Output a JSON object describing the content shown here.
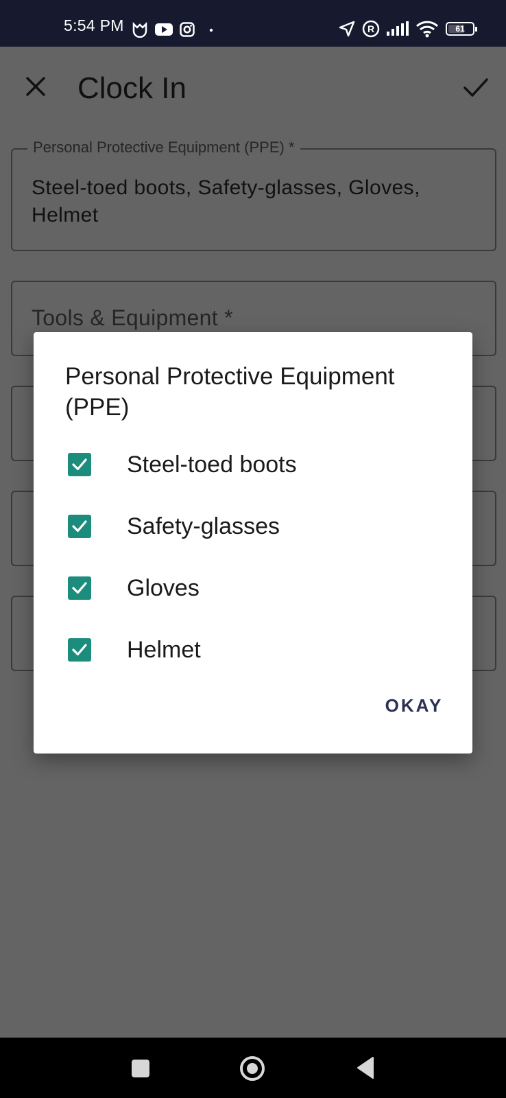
{
  "status_bar": {
    "time": "5:54 PM",
    "left_icons": [
      "mi-icon",
      "youtube-icon",
      "instagram-icon",
      "dot-icon"
    ],
    "right_icons": [
      "location-arrow-icon",
      "registered-icon",
      "signal-icon",
      "wifi-icon",
      "battery-icon"
    ],
    "battery_level": "61",
    "battery_fraction": 0.61
  },
  "app_bar": {
    "title": "Clock In",
    "close_icon": "close-icon",
    "confirm_icon": "check-icon"
  },
  "form": {
    "ppe_field": {
      "label": "Personal Protective Equipment (PPE) *",
      "value": "Steel-toed boots, Safety-glasses, Gloves, Helmet"
    },
    "tools_field": {
      "placeholder": "Tools & Equipment *"
    }
  },
  "dialog": {
    "title": "Personal Protective Equipment (PPE)",
    "options": [
      {
        "label": "Steel-toed boots",
        "checked": true
      },
      {
        "label": "Safety-glasses",
        "checked": true
      },
      {
        "label": "Gloves",
        "checked": true
      },
      {
        "label": "Helmet",
        "checked": true
      }
    ],
    "okay_label": "OKAY"
  },
  "colors": {
    "scrim": "#646464",
    "status_bar": "#171a2f",
    "checkbox": "#1c8c7d",
    "button_text": "#2b3055"
  }
}
